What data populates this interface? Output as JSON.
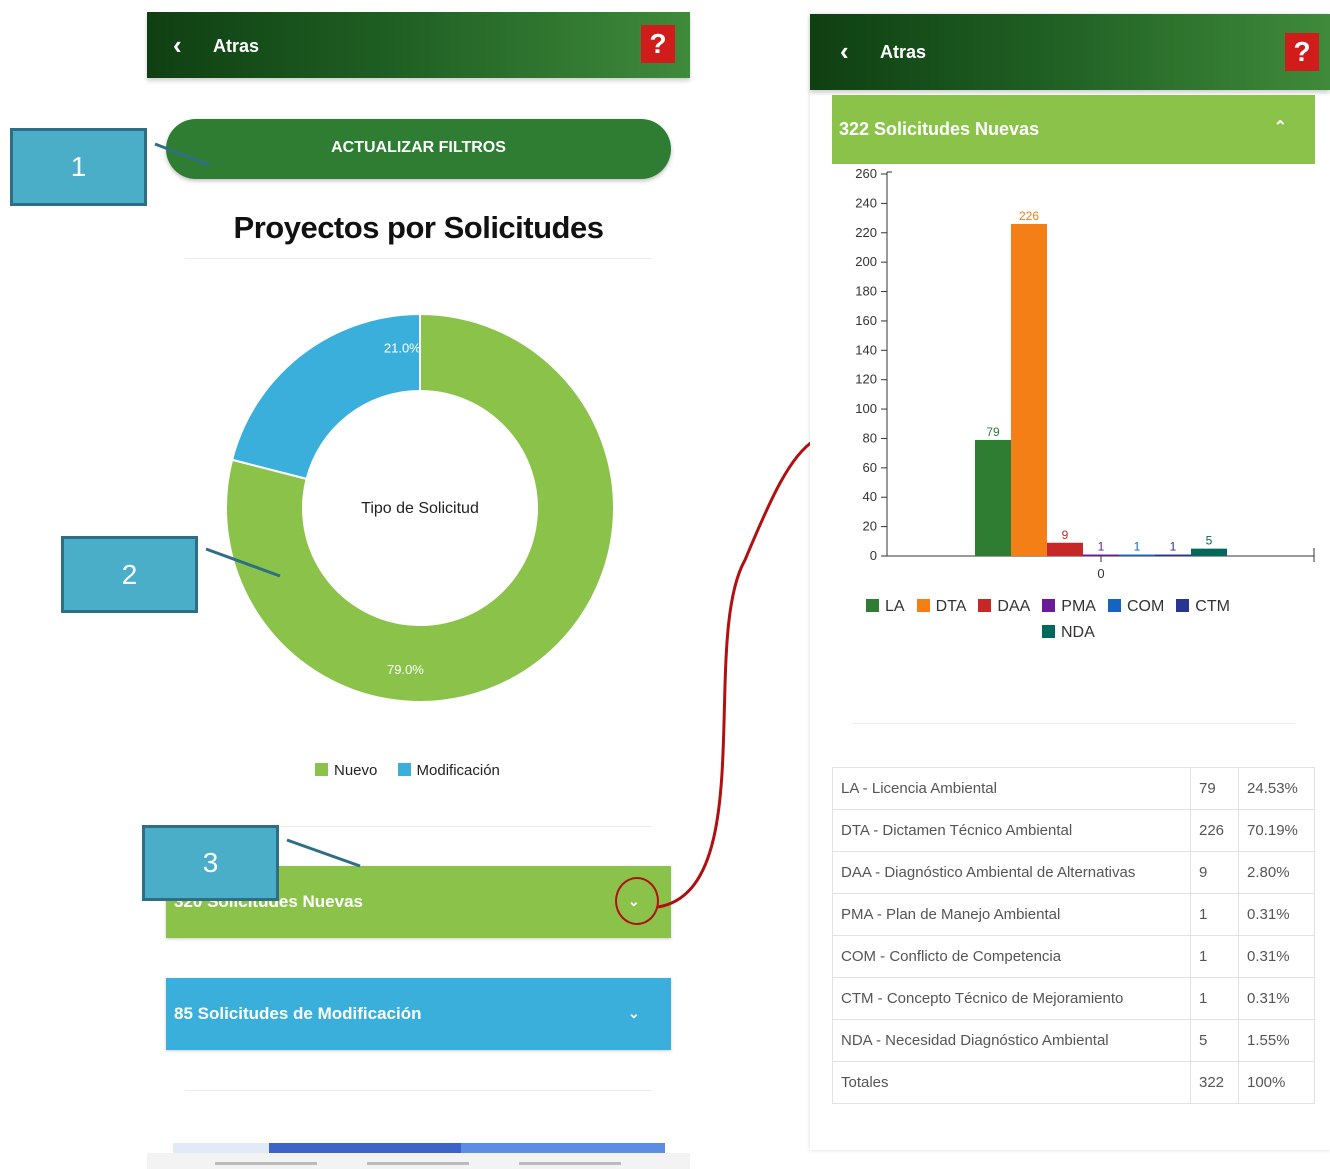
{
  "left_screen": {
    "header": {
      "back_icon": "chevron-left-icon",
      "back_label": "Atras",
      "help_label": "?"
    },
    "filter_button": "ACTUALIZAR FILTROS",
    "title": "Proyectos por Solicitudes",
    "donut_center_label": "Tipo de Solicitud",
    "legend": [
      {
        "label": "Nuevo",
        "color": "#8bc34a"
      },
      {
        "label": "Modificación",
        "color": "#3aafdc"
      }
    ],
    "accordion_new": "320 Solicitudes Nuevas",
    "accordion_mod": "85 Solicitudes de Modificación"
  },
  "callouts": [
    "1",
    "2",
    "3"
  ],
  "right_screen": {
    "header": {
      "back_label": "Atras",
      "help_label": "?"
    },
    "section_title": "322 Solicitudes Nuevas",
    "table": {
      "rows": [
        {
          "name": "LA - Licencia Ambiental",
          "count": "79",
          "pct": "24.53%"
        },
        {
          "name": "DTA - Dictamen Técnico Ambiental",
          "count": "226",
          "pct": "70.19%"
        },
        {
          "name": "DAA - Diagnóstico Ambiental de Alternativas",
          "count": "9",
          "pct": "2.80%"
        },
        {
          "name": "PMA - Plan de Manejo Ambiental",
          "count": "1",
          "pct": "0.31%"
        },
        {
          "name": "COM - Conflicto de Competencia",
          "count": "1",
          "pct": "0.31%"
        },
        {
          "name": "CTM - Concepto Técnico de Mejoramiento",
          "count": "1",
          "pct": "0.31%"
        },
        {
          "name": "NDA - Necesidad Diagnóstico Ambiental",
          "count": "5",
          "pct": "1.55%"
        },
        {
          "name": "Totales",
          "count": "322",
          "pct": "100%"
        }
      ]
    }
  },
  "chart_data": [
    {
      "type": "pie",
      "title": "Tipo de Solicitud",
      "categories": [
        "Nuevo",
        "Modificación"
      ],
      "values": [
        79.0,
        21.0
      ],
      "value_labels": [
        "79.0%",
        "21.0%"
      ],
      "colors": [
        "#8bc34a",
        "#3aafdc"
      ],
      "legend": "bottom"
    },
    {
      "type": "bar",
      "x": [
        "0"
      ],
      "ylim": [
        0,
        260
      ],
      "yticks": [
        0,
        20,
        40,
        60,
        80,
        100,
        120,
        140,
        160,
        180,
        200,
        220,
        240,
        260
      ],
      "series": [
        {
          "name": "LA",
          "values": [
            79
          ],
          "color": "#2e7d32"
        },
        {
          "name": "DTA",
          "values": [
            226
          ],
          "color": "#f57f17"
        },
        {
          "name": "DAA",
          "values": [
            9
          ],
          "color": "#c62828"
        },
        {
          "name": "PMA",
          "values": [
            1
          ],
          "color": "#6a1b9a"
        },
        {
          "name": "COM",
          "values": [
            1
          ],
          "color": "#1565c0"
        },
        {
          "name": "CTM",
          "values": [
            1
          ],
          "color": "#283593"
        },
        {
          "name": "NDA",
          "values": [
            5
          ],
          "color": "#00695c"
        }
      ],
      "legend": "bottom"
    }
  ]
}
